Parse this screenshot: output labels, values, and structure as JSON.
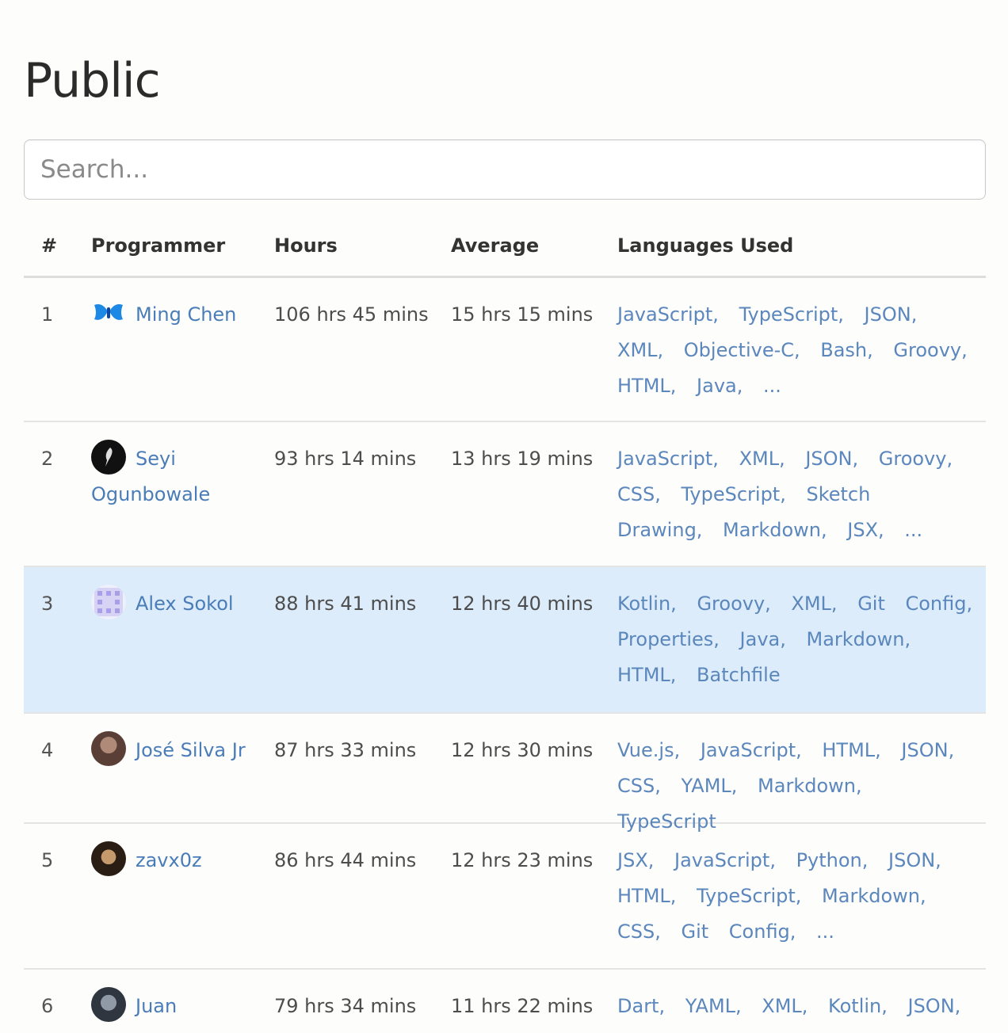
{
  "page": {
    "title": "Public"
  },
  "search": {
    "placeholder": "Search..."
  },
  "table": {
    "headers": {
      "rank": "#",
      "programmer": "Programmer",
      "hours": "Hours",
      "average": "Average",
      "languages": "Languages Used"
    },
    "rows": [
      {
        "rank": "1",
        "name": "Ming Chen",
        "hours": "106 hrs 45 mins",
        "average": "15 hrs 15 mins",
        "languages": "JavaScript, TypeScript, JSON, XML, Objective-C, Bash, Groovy, HTML, Java, ...",
        "avatar": "butterfly-avatar",
        "highlight": false
      },
      {
        "rank": "2",
        "name": "Seyi Ogunbowale",
        "hours": "93 hrs 14 mins",
        "average": "13 hrs 19 mins",
        "languages": "JavaScript, XML, JSON, Groovy, CSS, TypeScript, Sketch Drawing, Markdown, JSX, ...",
        "avatar": "dark-avatar",
        "highlight": false
      },
      {
        "rank": "3",
        "name": "Alex Sokol",
        "hours": "88 hrs 41 mins",
        "average": "12 hrs 40 mins",
        "languages": "Kotlin, Groovy, XML, Git Config, Properties, Java, Markdown, HTML, Batchfile",
        "avatar": "pattern-avatar",
        "highlight": true
      },
      {
        "rank": "4",
        "name": "José Silva Jr",
        "hours": "87 hrs 33 mins",
        "average": "12 hrs 30 mins",
        "languages": "Vue.js, JavaScript, HTML, JSON, CSS, YAML, Markdown, TypeScript",
        "avatar": "photo-avatar",
        "highlight": false
      },
      {
        "rank": "5",
        "name": "zavx0z",
        "hours": "86 hrs 44 mins",
        "average": "12 hrs 23 mins",
        "languages": "JSX, JavaScript, Python, JSON, HTML, TypeScript, Markdown, CSS, Git Config, ...",
        "avatar": "photo-avatar",
        "highlight": false
      },
      {
        "rank": "6",
        "name": "Juan",
        "hours": "79 hrs 34 mins",
        "average": "11 hrs 22 mins",
        "languages": "Dart, YAML, XML, Kotlin, JSON,",
        "avatar": "photo-avatar",
        "highlight": false
      }
    ]
  }
}
